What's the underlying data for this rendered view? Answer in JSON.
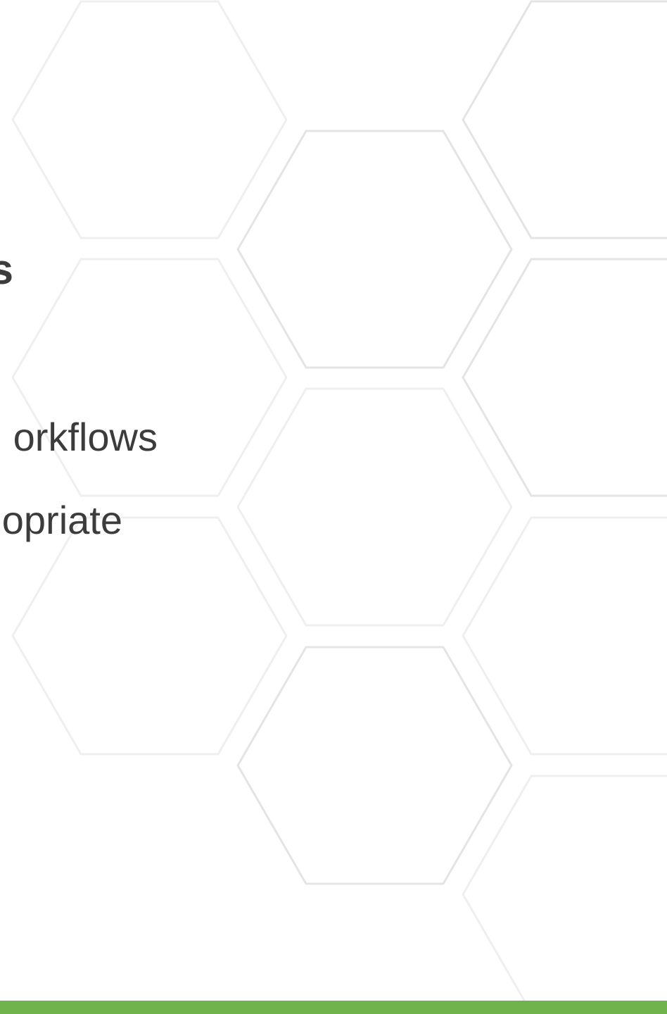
{
  "slide": {
    "heading_fragment": "s",
    "bullets": [
      "orkflows",
      "opriate"
    ]
  },
  "decoration": {
    "background_pattern": "hexagon-outline-grid",
    "hex_stroke_color": "#e4e4e4",
    "hex_faint_stroke_color": "#efefef"
  },
  "colors": {
    "background": "#ffffff",
    "text": "#3c3c3c",
    "accent_bar": "#70b24b"
  }
}
